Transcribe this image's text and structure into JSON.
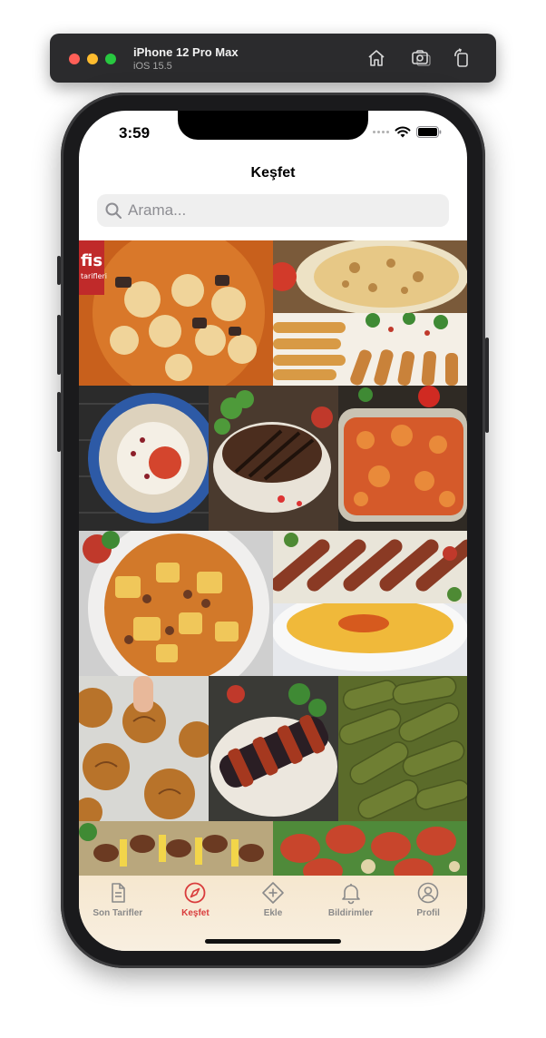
{
  "simulator": {
    "device_name": "iPhone 12 Pro Max",
    "os_version": "iOS 15.5"
  },
  "status_bar": {
    "time": "3:59"
  },
  "nav": {
    "title": "Keşfet"
  },
  "search": {
    "placeholder": "Arama..."
  },
  "grid": {
    "photos": [
      "lentil-dumpling-soup",
      "baked-cheese-dish",
      "cigar-rolls-yogurt",
      "yogurt-mezze-plate",
      "grilled-steak",
      "baked-casserole",
      "meat-potato-stew",
      "kebab-skewers",
      "lentil-soup",
      "bread-rolls",
      "eggplant-kebab",
      "stuffed-grape-leaves",
      "meatball-tray",
      "raw-kofte"
    ],
    "partial_logo_text": "fis",
    "partial_logo_sub": "tarifleri"
  },
  "tabs": [
    {
      "label": "Son Tarifler",
      "icon": "document-icon",
      "active": false
    },
    {
      "label": "Keşfet",
      "icon": "compass-icon",
      "active": true
    },
    {
      "label": "Ekle",
      "icon": "add-icon",
      "active": false
    },
    {
      "label": "Bildirimler",
      "icon": "bell-icon",
      "active": false
    },
    {
      "label": "Profil",
      "icon": "profile-icon",
      "active": false
    }
  ],
  "colors": {
    "accent": "#d93c3c",
    "tab_inactive": "#8a8a8a",
    "tabbar_bg": "#f6e7cf",
    "search_bg": "#efefef"
  }
}
